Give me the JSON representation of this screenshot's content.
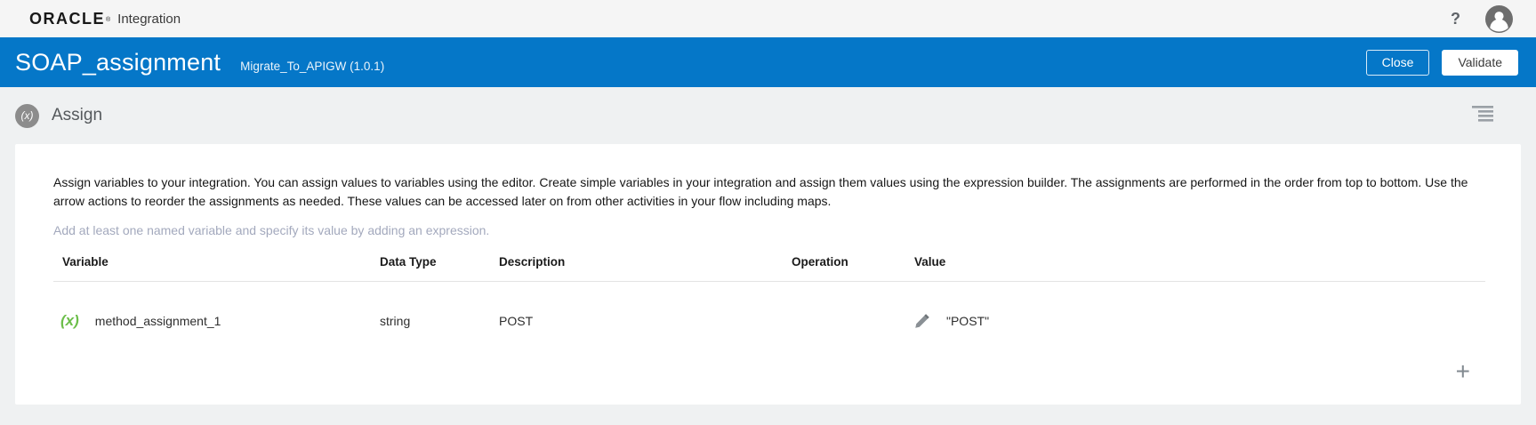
{
  "topbar": {
    "brand": "ORACLE",
    "trademark": "®",
    "product": "Integration",
    "help_label": "?"
  },
  "header": {
    "title": "SOAP_assignment",
    "subtitle": "Migrate_To_APIGW (1.0.1)",
    "buttons": {
      "close": "Close",
      "validate": "Validate"
    }
  },
  "section": {
    "icon_label": "(x)",
    "title": "Assign"
  },
  "panel": {
    "description": "Assign variables to your integration. You can assign values to variables using the editor. Create simple variables in your integration and assign them values using the expression builder. The assignments are performed in the order from top to bottom. Use the arrow actions to reorder the assignments as needed. These values can be accessed later on from other activities in your flow including maps.",
    "hint": "Add at least one named variable and specify its value by adding an expression.",
    "table": {
      "columns": [
        "Variable",
        "Data Type",
        "Description",
        "Operation",
        "Value"
      ],
      "rows": [
        {
          "icon": "(x)",
          "variable": "method_assignment_1",
          "data_type": "string",
          "description": "POST",
          "operation": "",
          "value": "\"POST\""
        }
      ]
    },
    "add_button": "+"
  },
  "colors": {
    "header_blue": "#0577c8",
    "accent_green": "#6cbe4a"
  }
}
